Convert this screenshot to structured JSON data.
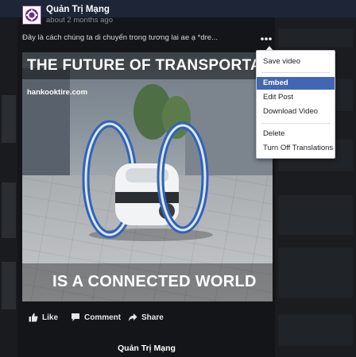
{
  "post": {
    "page_name": "Quản Trị Mạng",
    "time": "about 2 months ago",
    "text": "Đây là cách chúng ta di chuyển trong tương lai ae ạ *dre...",
    "more_icon": "ellipsis-icon"
  },
  "video": {
    "title": "THE FUTURE OF TRANSPORTATIO",
    "source": "hankooktire.com",
    "caption": "IS A CONNECTED WORLD"
  },
  "menu": {
    "items": [
      {
        "label": "Save video"
      },
      {
        "label": "Embed",
        "selected": true
      },
      {
        "label": "Edit Post"
      },
      {
        "label": "Download Video"
      },
      {
        "label": "Delete"
      },
      {
        "label": "Turn Off Translations"
      }
    ]
  },
  "actions": {
    "like": "Like",
    "comment": "Comment",
    "share": "Share"
  },
  "footer": {
    "page_name": "Quản Trị Mạng"
  },
  "colors": {
    "accent": "#4267b2",
    "background": "#141518",
    "menu_bg": "#ffffff"
  }
}
